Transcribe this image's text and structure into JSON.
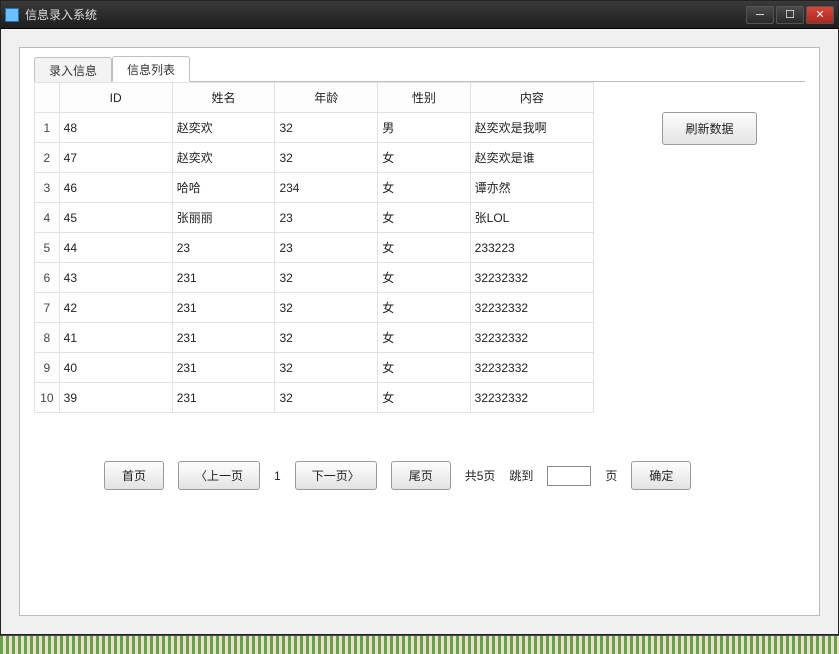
{
  "window": {
    "title": "信息录入系统"
  },
  "tabs": [
    {
      "label": "录入信息",
      "active": false
    },
    {
      "label": "信息列表",
      "active": true
    }
  ],
  "table": {
    "headers": [
      "ID",
      "姓名",
      "年龄",
      "性别",
      "内容"
    ],
    "rows": [
      {
        "n": "1",
        "id": "48",
        "name": "赵奕欢",
        "age": "32",
        "gender": "男",
        "content": "赵奕欢是我啊"
      },
      {
        "n": "2",
        "id": "47",
        "name": "赵奕欢",
        "age": "32",
        "gender": "女",
        "content": "赵奕欢是谁"
      },
      {
        "n": "3",
        "id": "46",
        "name": "哈哈",
        "age": "234",
        "gender": "女",
        "content": "谭亦然"
      },
      {
        "n": "4",
        "id": "45",
        "name": "张丽丽",
        "age": "23",
        "gender": "女",
        "content": "张LOL"
      },
      {
        "n": "5",
        "id": "44",
        "name": "23",
        "age": "23",
        "gender": "女",
        "content": "233223"
      },
      {
        "n": "6",
        "id": "43",
        "name": "231",
        "age": "32",
        "gender": "女",
        "content": "32232332"
      },
      {
        "n": "7",
        "id": "42",
        "name": "231",
        "age": "32",
        "gender": "女",
        "content": "32232332"
      },
      {
        "n": "8",
        "id": "41",
        "name": "231",
        "age": "32",
        "gender": "女",
        "content": "32232332"
      },
      {
        "n": "9",
        "id": "40",
        "name": "231",
        "age": "32",
        "gender": "女",
        "content": "32232332"
      },
      {
        "n": "10",
        "id": "39",
        "name": "231",
        "age": "32",
        "gender": "女",
        "content": "32232332"
      }
    ]
  },
  "side": {
    "refresh_label": "刷新数据"
  },
  "pager": {
    "first": "首页",
    "prev": "〈上一页",
    "current": "1",
    "next": "下一页〉",
    "last": "尾页",
    "total": "共5页",
    "jump_label": "跳到",
    "page_suffix": "页",
    "confirm": "确定",
    "jump_value": ""
  }
}
